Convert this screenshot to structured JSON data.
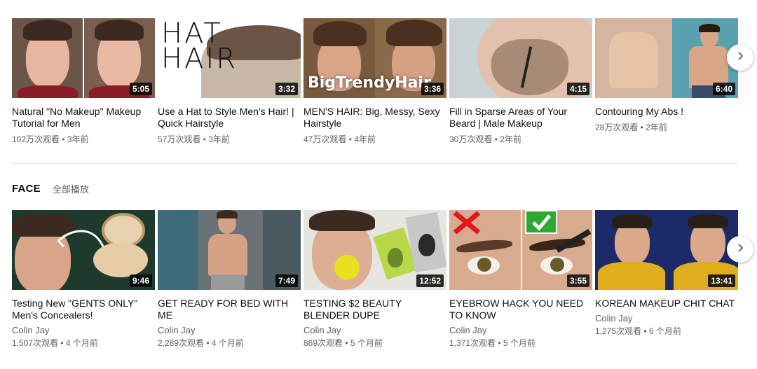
{
  "shelf1": {
    "videos": [
      {
        "title": "Natural \"No Makeup\" Makeup Tutorial for Men",
        "duration": "5:05",
        "meta": "102万次观看 • 3年前"
      },
      {
        "title": "Use a Hat to Style Men's Hair! | Quick Hairstyle",
        "duration": "3:32",
        "meta": "57万次观看 • 3年前",
        "overlay_text": "HAT HAIR"
      },
      {
        "title": "MEN'S HAIR: Big, Messy, Sexy Hairstyle",
        "duration": "3:36",
        "meta": "47万次观看 • 4年前",
        "overlay_text": "BigTrendyHair"
      },
      {
        "title": "Fill in Sparse Areas of Your Beard | Male Makeup",
        "duration": "4:15",
        "meta": "30万次观看 • 2年前"
      },
      {
        "title": "Contouring My Abs !",
        "duration": "6:40",
        "meta": "28万次观看 • 2年前"
      }
    ],
    "next_icon": "chevron-right-icon"
  },
  "shelf2": {
    "title": "FACE",
    "play_all": "全部播放",
    "videos": [
      {
        "title": "Testing New \"GENTS ONLY\" Men's Concealers!",
        "channel": "Colin Jay",
        "duration": "9:46",
        "meta": "1,507次观看 • 4 个月前"
      },
      {
        "title": "GET READY FOR BED WITH ME",
        "channel": "Colin Jay",
        "duration": "7:49",
        "meta": "2,289次观看 • 4 个月前"
      },
      {
        "title": "TESTING $2 BEAUTY BLENDER DUPE",
        "channel": "Colin Jay",
        "duration": "12:52",
        "meta": "869次观看 • 5 个月前"
      },
      {
        "title": "EYEBROW HACK YOU NEED TO KNOW",
        "channel": "Colin Jay",
        "duration": "3:55",
        "meta": "1,371次观看 • 5 个月前"
      },
      {
        "title": "KOREAN MAKEUP CHIT CHAT",
        "channel": "Colin Jay",
        "duration": "13:41",
        "meta": "1,275次观看 • 6 个月前"
      }
    ],
    "next_icon": "chevron-right-icon"
  },
  "colors": {
    "duration_bg": "#000000",
    "meta_text": "#606060",
    "title_text": "#0f0f0f"
  }
}
